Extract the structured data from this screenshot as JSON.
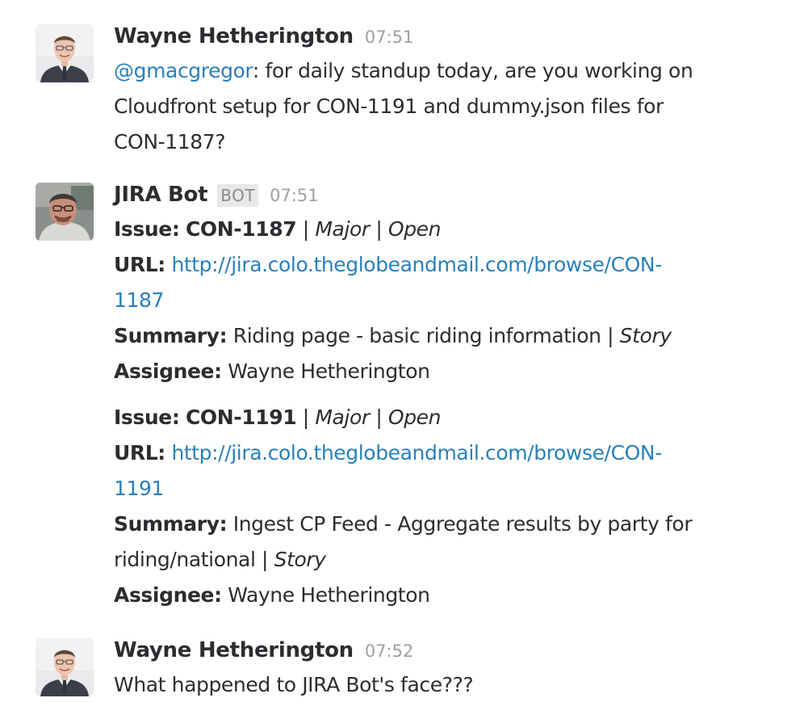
{
  "messages": [
    {
      "sender": "Wayne Hetherington",
      "timestamp": "07:51",
      "avatar": "wayne-avatar",
      "mention": "@gmacgregor",
      "mention_suffix": ":  for daily standup today, are you working on",
      "line2": "Cloudfront setup for CON-1191 and dummy.json files for",
      "line3": "CON-1187?"
    },
    {
      "sender": "JIRA Bot",
      "bot_tag": "BOT",
      "timestamp": "07:51",
      "avatar": "jira-bot-avatar",
      "issues": [
        {
          "issue_label": "Issue:",
          "issue_key": "CON-1187",
          "sep1": " | ",
          "priority": "Major",
          "sep2": " | ",
          "status": "Open",
          "url_label": "URL:",
          "url_part1": "http://jira.colo.theglobeandmail.com/browse/CON-",
          "url_part2": "1187",
          "summary_label": "Summary:",
          "summary_text": "Riding page - basic riding information",
          "summary_sep": " | ",
          "type": "Story",
          "assignee_label": "Assignee:",
          "assignee": "Wayne Hetherington"
        },
        {
          "issue_label": "Issue:",
          "issue_key": "CON-1191",
          "sep1": " | ",
          "priority": "Major",
          "sep2": " | ",
          "status": "Open",
          "url_label": "URL:",
          "url_part1": "http://jira.colo.theglobeandmail.com/browse/CON-",
          "url_part2": "1191",
          "summary_label": "Summary:",
          "summary_text_1": "Ingest CP Feed - Aggregate results by party for",
          "summary_text_2": "riding/national",
          "summary_sep": " | ",
          "type": "Story",
          "assignee_label": "Assignee:",
          "assignee": "Wayne Hetherington"
        }
      ]
    },
    {
      "sender": "Wayne Hetherington",
      "timestamp": "07:52",
      "avatar": "wayne-avatar",
      "text": "What happened to JIRA Bot's face???"
    }
  ],
  "colors": {
    "link": "#2a80b9",
    "text": "#2c2d30",
    "timestamp": "#a0a0a2",
    "bot_tag_bg": "#e8e8e8"
  }
}
